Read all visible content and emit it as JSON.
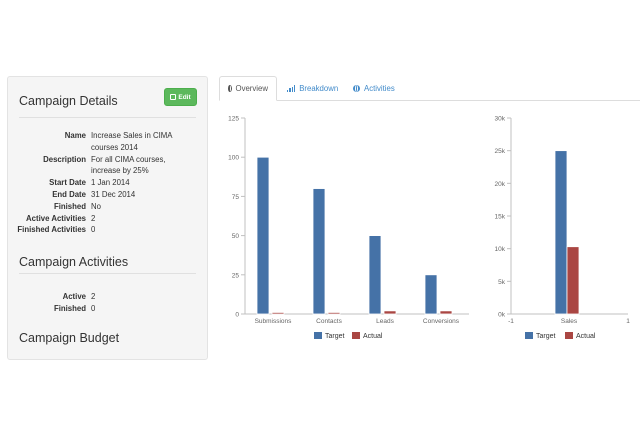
{
  "sidebar": {
    "details_title": "Campaign Details",
    "edit_label": "Edit",
    "details": [
      {
        "label": "Name",
        "value": "Increase Sales in CIMA courses 2014"
      },
      {
        "label": "Description",
        "value": "For all CIMA courses, increase by 25%"
      },
      {
        "label": "Start Date",
        "value": "1 Jan 2014"
      },
      {
        "label": "End Date",
        "value": "31 Dec 2014"
      },
      {
        "label": "Finished",
        "value": "No"
      },
      {
        "label": "Active Activities",
        "value": "2"
      },
      {
        "label": "Finished Activities",
        "value": "0"
      }
    ],
    "activities_title": "Campaign Activities",
    "activities": [
      {
        "label": "Active",
        "value": "2"
      },
      {
        "label": "Finished",
        "value": "0"
      }
    ],
    "budget_title": "Campaign Budget"
  },
  "tabs": [
    {
      "label": "Overview",
      "icon": "globe-icon",
      "active": true
    },
    {
      "label": "Breakdown",
      "icon": "bar-chart-icon",
      "active": false
    },
    {
      "label": "Activities",
      "icon": "globe-icon",
      "active": false
    }
  ],
  "colors": {
    "target": "#4572a7",
    "actual": "#aa4643",
    "link": "#428bca",
    "edit": "#5cb85c"
  },
  "chart_data": [
    {
      "type": "bar",
      "categories": [
        "Submissions",
        "Contacts",
        "Leads",
        "Conversions"
      ],
      "series": [
        {
          "name": "Target",
          "values": [
            100,
            80,
            50,
            25
          ]
        },
        {
          "name": "Actual",
          "values": [
            1,
            1,
            2,
            2
          ]
        }
      ],
      "ylim": [
        0,
        125
      ],
      "yticks": [
        0,
        25,
        50,
        75,
        100,
        125
      ],
      "ytick_labels": [
        "0",
        "25",
        "50",
        "75",
        "100",
        "125"
      ],
      "legend": "bottom-center",
      "grid": false
    },
    {
      "type": "bar",
      "categories": [
        "Sales"
      ],
      "series": [
        {
          "name": "Target",
          "values": [
            25000
          ]
        },
        {
          "name": "Actual",
          "values": [
            10300
          ]
        }
      ],
      "ylim": [
        0,
        30000
      ],
      "yticks": [
        0,
        5000,
        10000,
        15000,
        20000,
        25000,
        30000
      ],
      "ytick_labels": [
        "0k",
        "5k",
        "10k",
        "15k",
        "20k",
        "25k",
        "30k"
      ],
      "xtick_labels": [
        "-1",
        "Sales",
        "1"
      ],
      "legend": "bottom-center",
      "grid": false
    }
  ]
}
